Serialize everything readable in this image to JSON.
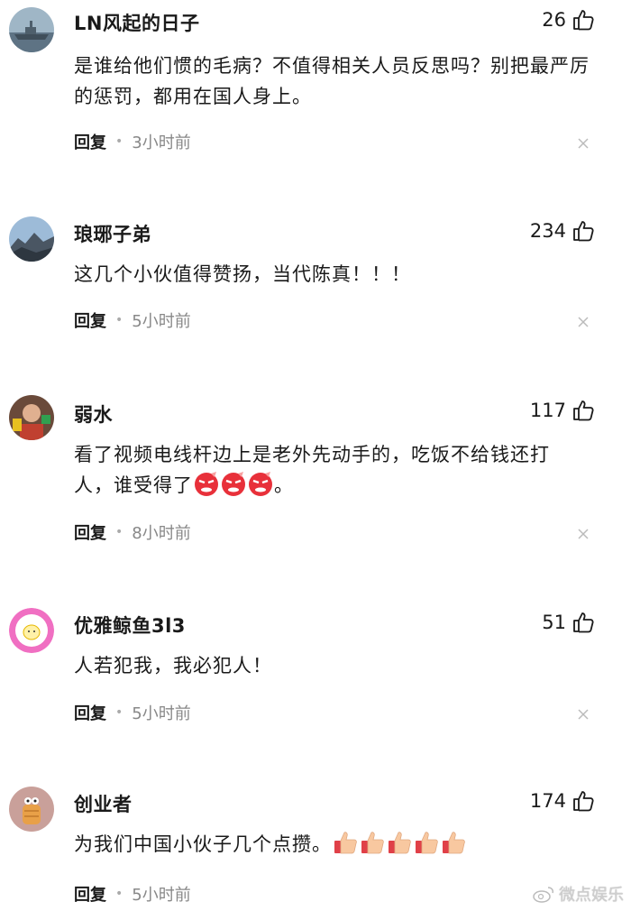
{
  "comments": [
    {
      "username": "LN风起的日子",
      "likes": "26",
      "text": "是谁给他们惯的毛病？不值得相关人员反思吗？别把最严厉的惩罚，都用在国人身上。",
      "reply": "回复",
      "time": "3小时前",
      "avatar": "warship-avatar"
    },
    {
      "username": "琅琊子弟",
      "likes": "234",
      "text": "这几个小伙值得赞扬，当代陈真！！！",
      "reply": "回复",
      "time": "5小时前",
      "avatar": "mountain-avatar"
    },
    {
      "username": "弱水",
      "likes": "117",
      "text_line1": "看了视频电线杆边上是老外先动手的，吃饭不给钱还打",
      "text_line2": "人，谁受得了",
      "text_end": "。",
      "reply": "回复",
      "time": "8小时前",
      "avatar": "person-avatar",
      "emojis": [
        "angry-face-emoji",
        "angry-face-emoji",
        "angry-face-emoji"
      ]
    },
    {
      "username": "优雅鲸鱼3l3",
      "likes": "51",
      "text": "人若犯我，我必犯人！",
      "reply": "回复",
      "time": "5小时前",
      "avatar": "fried-egg-avatar"
    },
    {
      "username": "创业者",
      "likes": "174",
      "text": "为我们中国小伙子几个点攒。",
      "reply": "回复",
      "time": "5小时前",
      "avatar": "bread-cartoon-avatar",
      "emojis": [
        "thumbs-up-emoji",
        "thumbs-up-emoji",
        "thumbs-up-emoji",
        "thumbs-up-emoji",
        "thumbs-up-emoji"
      ]
    }
  ],
  "watermark": {
    "text": "微点娱乐",
    "icon": "weibo-logo-icon"
  }
}
